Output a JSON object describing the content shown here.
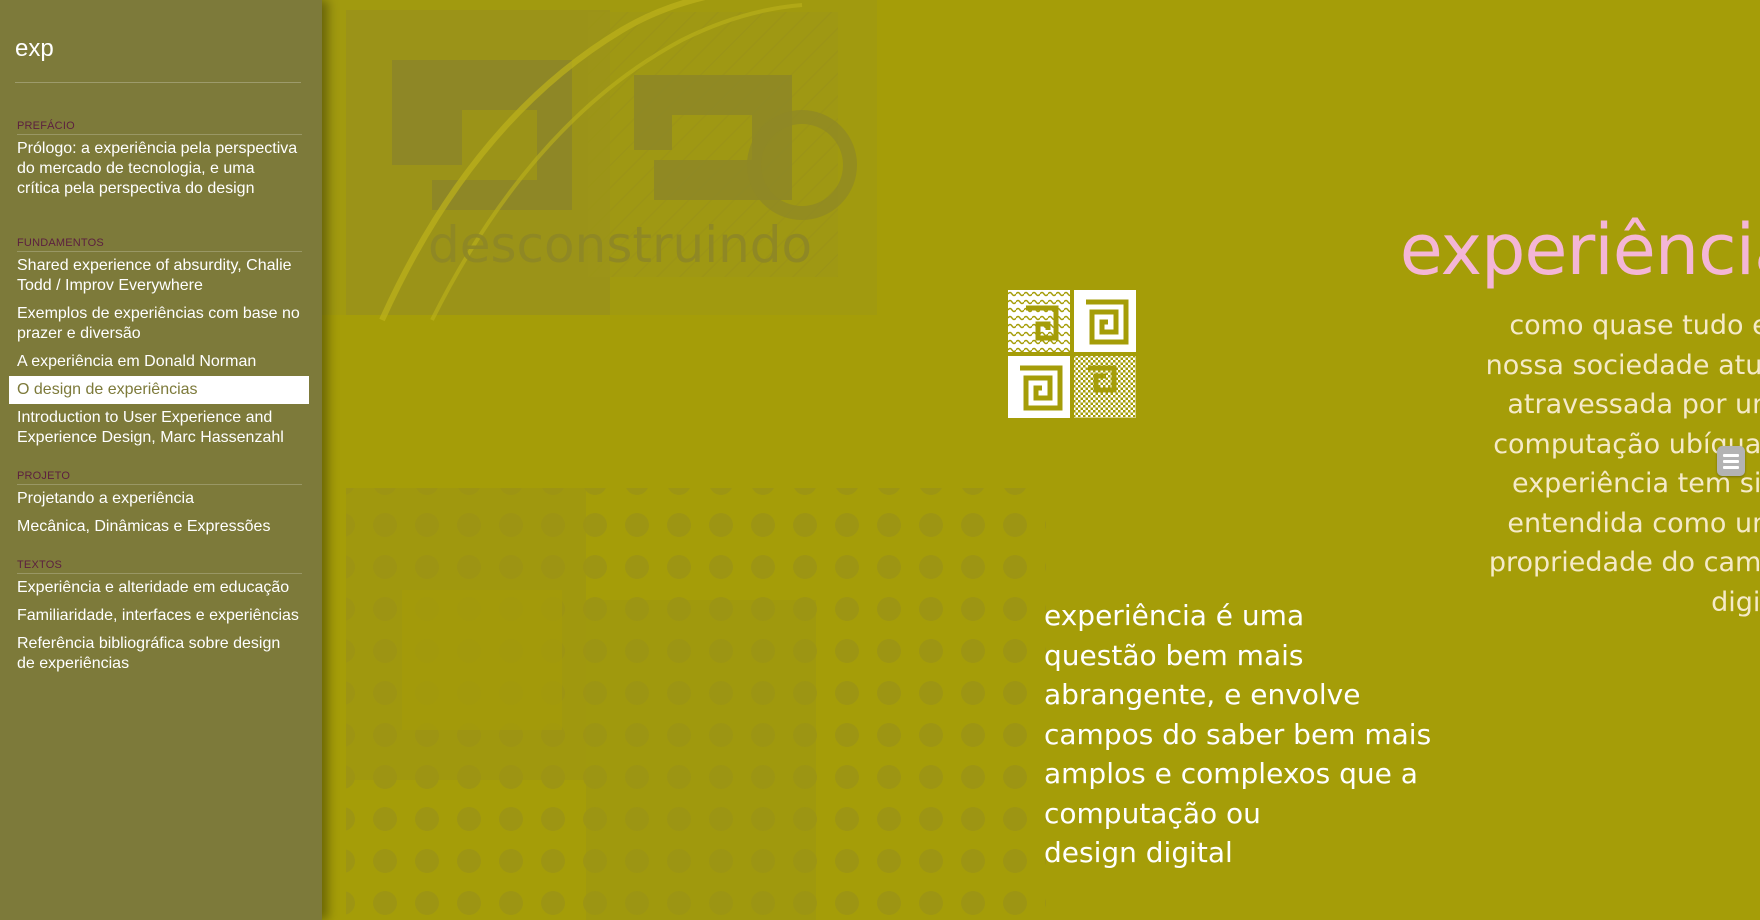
{
  "search": {
    "value": "exp",
    "placeholder": ""
  },
  "toc": {
    "sections": [
      {
        "title": "PREFÁCIO",
        "items": [
          {
            "label": "Prólogo: a experiência pela perspectiva do mercado de tecnologia, e uma crítica pela perspectiva do design"
          }
        ]
      },
      {
        "title": "FUNDAMENTOS",
        "items": [
          {
            "label": "Shared experience of absurdity, Chalie Todd / Improv Everywhere"
          },
          {
            "label": "Exemplos de experiências com base no prazer e diversão"
          },
          {
            "label": "A experiência em Donald Norman"
          },
          {
            "label": "O design de experiências"
          },
          {
            "label": "Introduction to User Experience and Experience Design, Marc Hassenzahl"
          }
        ]
      },
      {
        "title": "PROJETO",
        "items": [
          {
            "label": "Projetando a experiência"
          },
          {
            "label": "Mecânica, Dinâmicas e Expressões"
          }
        ]
      },
      {
        "title": "TEXTOS",
        "items": [
          {
            "label": "Experiência e alteridade em educação"
          },
          {
            "label": "Familiaridade, interfaces e experiências"
          },
          {
            "label": "Referência bibliográfica sobre design de experiências"
          }
        ]
      }
    ],
    "active_item": "O design de experiências"
  },
  "hero": {
    "background_watermark": "desconstruindo",
    "title": "experiência",
    "intro": "como quase tudo em\nnossa sociedade atual,\natravessada por uma\ncomputação ubíqua, a\nexperiência tem sido\nentendida como uma\npropriedade do campo\ndigital",
    "body": "experiência é uma\nquestão bem mais\nabrangente, e envolve\ncampos do saber bem mais\namplos e complexos que a\ncomputação ou\ndesign digital"
  },
  "icons": {
    "menu_toggle": "hamburger-menu-icon",
    "logo": "spiral-squares-logo-icon"
  },
  "colors": {
    "sidebar_bg": "#7d7a3a",
    "main_bg": "#a59d08",
    "title_pink": "#f4b6d6",
    "section_label": "#5c1f3f",
    "active_bg": "#ffffff"
  }
}
